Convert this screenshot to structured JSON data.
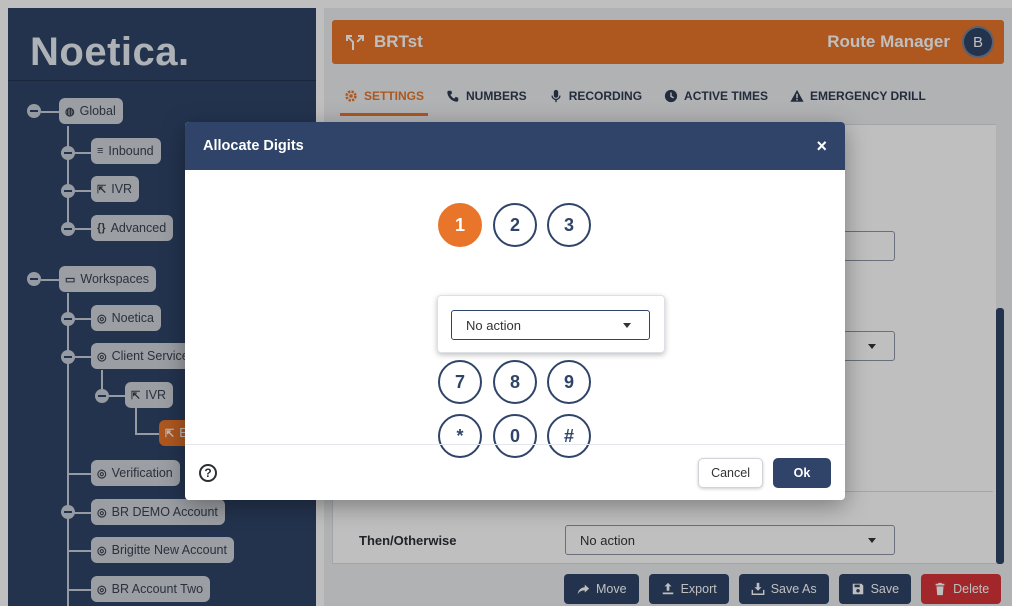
{
  "brand": {
    "name": "Noetica",
    "dot": "."
  },
  "tree": {
    "global": "Global",
    "inbound": "Inbound",
    "ivr": "IVR",
    "advanced": "Advanced",
    "workspaces": "Workspaces",
    "noetica": "Noetica",
    "client_service": "Client Service",
    "ivr_child": "IVR",
    "active_fragment": "E",
    "verification": "Verification",
    "br_demo": "BR DEMO Account",
    "brigitte": "Brigitte New Account",
    "br_two": "BR Account Two"
  },
  "header": {
    "title": "BRTst",
    "section": "Route Manager",
    "avatar": "B"
  },
  "tabs": [
    {
      "label": "SETTINGS",
      "icon": "gear-icon"
    },
    {
      "label": "NUMBERS",
      "icon": "phone-icon"
    },
    {
      "label": "RECORDING",
      "icon": "microphone-icon"
    },
    {
      "label": "ACTIVE TIMES",
      "icon": "clock-icon"
    },
    {
      "label": "EMERGENCY DRILL",
      "icon": "warning-icon"
    }
  ],
  "background_form": {
    "then_otherwise_label": "Then/Otherwise",
    "then_otherwise_value": "No action"
  },
  "actions": {
    "move": "Move",
    "export": "Export",
    "save_as": "Save As",
    "save": "Save",
    "delete": "Delete"
  },
  "dialog": {
    "title": "Allocate Digits",
    "close": "×",
    "keys": [
      "1",
      "2",
      "3",
      "7",
      "8",
      "9",
      "*",
      "0",
      "#"
    ],
    "selected_key": "1",
    "action_select": "No action",
    "help": "?",
    "cancel": "Cancel",
    "ok": "Ok"
  },
  "colors": {
    "navy": "#2f4468",
    "orange": "#e8752a",
    "danger": "#d8343a"
  }
}
